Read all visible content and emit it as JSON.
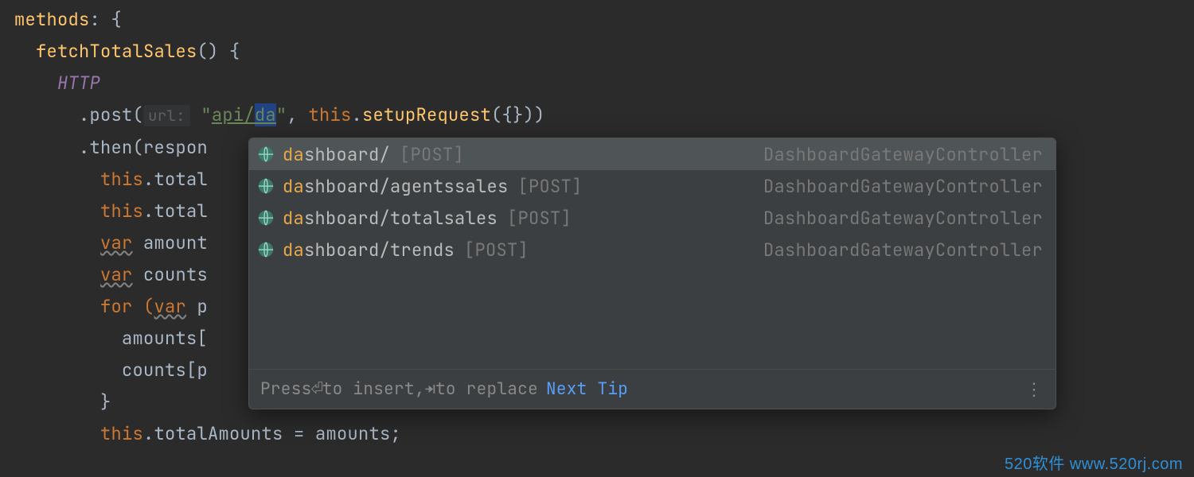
{
  "code": {
    "line1_prop": "methods",
    "line1_after": ": {",
    "line2_fn": "fetchTotalSales",
    "line2_after": "() {",
    "line3_http": "HTTP",
    "line4_dot_post": ".post(",
    "line4_hint": "url:",
    "line4_quote1": "\"",
    "line4_url_plain": "api/",
    "line4_url_typed": "da",
    "line4_quote2": "\"",
    "line4_comma": ", ",
    "line4_this": "this",
    "line4_dot": ".",
    "line4_setup": "setupRequest",
    "line4_setup_args": "({}))",
    "line5_then": ".then(respon",
    "line6_this": "this",
    "line6_dot_total": ".total",
    "line7_this": "this",
    "line7_dot_total": ".total",
    "line8_var": "var",
    "line8_amount": " amount",
    "line9_var": "var",
    "line9_counts": " counts",
    "line10_for": "for (",
    "line10_var": "var",
    "line10_p": " p",
    "line11_amounts": "amounts[",
    "line12_counts": "counts[p",
    "line13_brace": "}",
    "line14_this": "this",
    "line14_rest": ".totalAmounts = amounts;"
  },
  "popup": {
    "items": [
      {
        "prefix": "da",
        "rest": "shboard/",
        "method": "[POST]",
        "origin": "DashboardGatewayController"
      },
      {
        "prefix": "da",
        "rest": "shboard/agentssales",
        "method": "[POST]",
        "origin": "DashboardGatewayController"
      },
      {
        "prefix": "da",
        "rest": "shboard/totalsales",
        "method": "[POST]",
        "origin": "DashboardGatewayController"
      },
      {
        "prefix": "da",
        "rest": "shboard/trends",
        "method": "[POST]",
        "origin": "DashboardGatewayController"
      }
    ],
    "footer_press": "Press ",
    "footer_insert": " to insert, ",
    "footer_replace": " to replace",
    "footer_enter": "⏎",
    "footer_tab": "⇥",
    "footer_next": "Next Tip"
  },
  "watermark": "520软件 www.520rj.com"
}
